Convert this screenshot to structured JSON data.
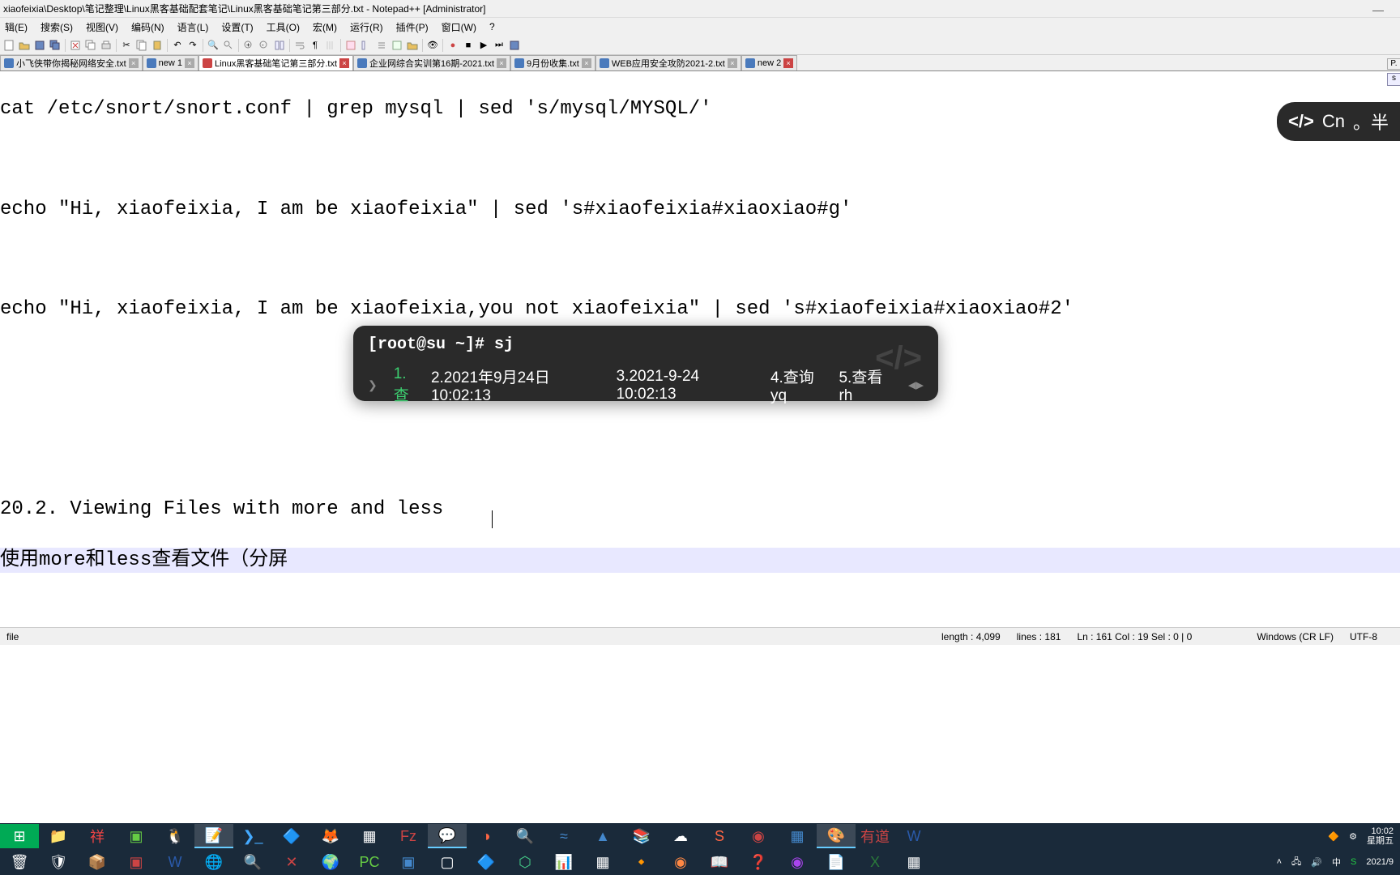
{
  "title": "xiaofeixia\\Desktop\\笔记整理\\Linux黑客基础配套笔记\\Linux黑客基础笔记第三部分.txt - Notepad++ [Administrator]",
  "menu": [
    "辑(E)",
    "搜索(S)",
    "视图(V)",
    "编码(N)",
    "语言(L)",
    "设置(T)",
    "工具(O)",
    "宏(M)",
    "运行(R)",
    "插件(P)",
    "窗口(W)",
    "?"
  ],
  "tabs": [
    {
      "label": "小飞侠带你揭秘网络安全.txt",
      "active": false,
      "saved": true
    },
    {
      "label": "new 1",
      "active": false,
      "saved": true
    },
    {
      "label": "Linux黑客基础笔记第三部分.txt",
      "active": true,
      "saved": false
    },
    {
      "label": "企业网综合实训第16期-2021.txt",
      "active": false,
      "saved": true
    },
    {
      "label": "9月份收集.txt",
      "active": false,
      "saved": true
    },
    {
      "label": "WEB应用安全攻防2021-2.txt",
      "active": false,
      "saved": true
    },
    {
      "label": "new 2",
      "active": false,
      "saved": true
    }
  ],
  "editor": {
    "lines": [
      "cat /etc/snort/snort.conf | grep mysql | sed 's/mysql/MYSQL/'",
      "",
      "echo \"Hi, xiaofeixia, I am be xiaofeixia\" | sed 's#xiaofeixia#xiaoxiao#g'",
      "",
      "echo \"Hi, xiaofeixia, I am be xiaofeixia,you not xiaofeixia\" | sed 's#xiaofeixia#xiaoxiao#2'",
      "",
      "",
      "",
      "20.2. Viewing Files with more and less",
      "使用more和less查看文件（分屏"
    ]
  },
  "status": {
    "file_type": "file",
    "length": "length : 4,099",
    "lines": "lines : 181",
    "pos": "Ln : 161   Col : 19   Sel : 0 | 0",
    "eol": "Windows (CR LF)",
    "enc": "UTF-8"
  },
  "ime": {
    "prompt": "[root@su ~]# sj",
    "candidates": [
      "1.查",
      "2.2021年9月24日10:02:13",
      "3.2021-9-24 10:02:13",
      "4.查询yq",
      "5.查看rh"
    ]
  },
  "float": {
    "lang": "Cn",
    "mode": "。半"
  },
  "tray": {
    "lang": "中",
    "day": "星期五",
    "time": "10:02",
    "date": "2021/9"
  },
  "side_tab": "P.",
  "side_btn": "s"
}
